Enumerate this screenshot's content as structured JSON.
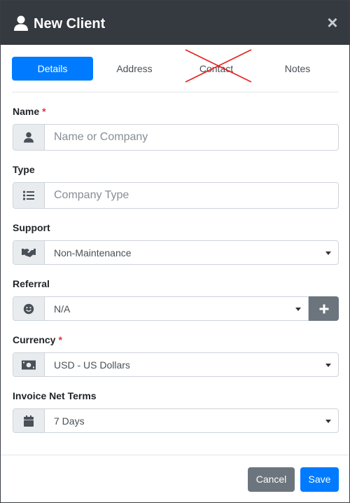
{
  "header": {
    "title": "New Client",
    "icon": "user-icon",
    "close_label": "×"
  },
  "tabs": [
    {
      "label": "Details",
      "active": true
    },
    {
      "label": "Address",
      "active": false
    },
    {
      "label": "Contact",
      "active": false,
      "crossed_out": true
    },
    {
      "label": "Notes",
      "active": false
    }
  ],
  "fields": {
    "name": {
      "label": "Name",
      "required_mark": "*",
      "placeholder": "Name or Company",
      "value": "",
      "icon": "user-icon"
    },
    "type": {
      "label": "Type",
      "placeholder": "Company Type",
      "value": "",
      "icon": "list-icon"
    },
    "support": {
      "label": "Support",
      "value": "Non-Maintenance",
      "icon": "handshake-icon"
    },
    "referral": {
      "label": "Referral",
      "value": "N/A",
      "icon": "smile-icon",
      "add_label": "+"
    },
    "currency": {
      "label": "Currency",
      "required_mark": "*",
      "value": "USD - US Dollars",
      "icon": "money-bill-icon"
    },
    "invoice_net_terms": {
      "label": "Invoice Net Terms",
      "value": "7 Days",
      "icon": "calendar-icon"
    }
  },
  "footer": {
    "cancel_label": "Cancel",
    "save_label": "Save"
  },
  "colors": {
    "header_bg": "#343a40",
    "primary": "#007bff",
    "secondary": "#6c757d",
    "required": "#dc3545",
    "annotation_cross": "#e8201c"
  }
}
